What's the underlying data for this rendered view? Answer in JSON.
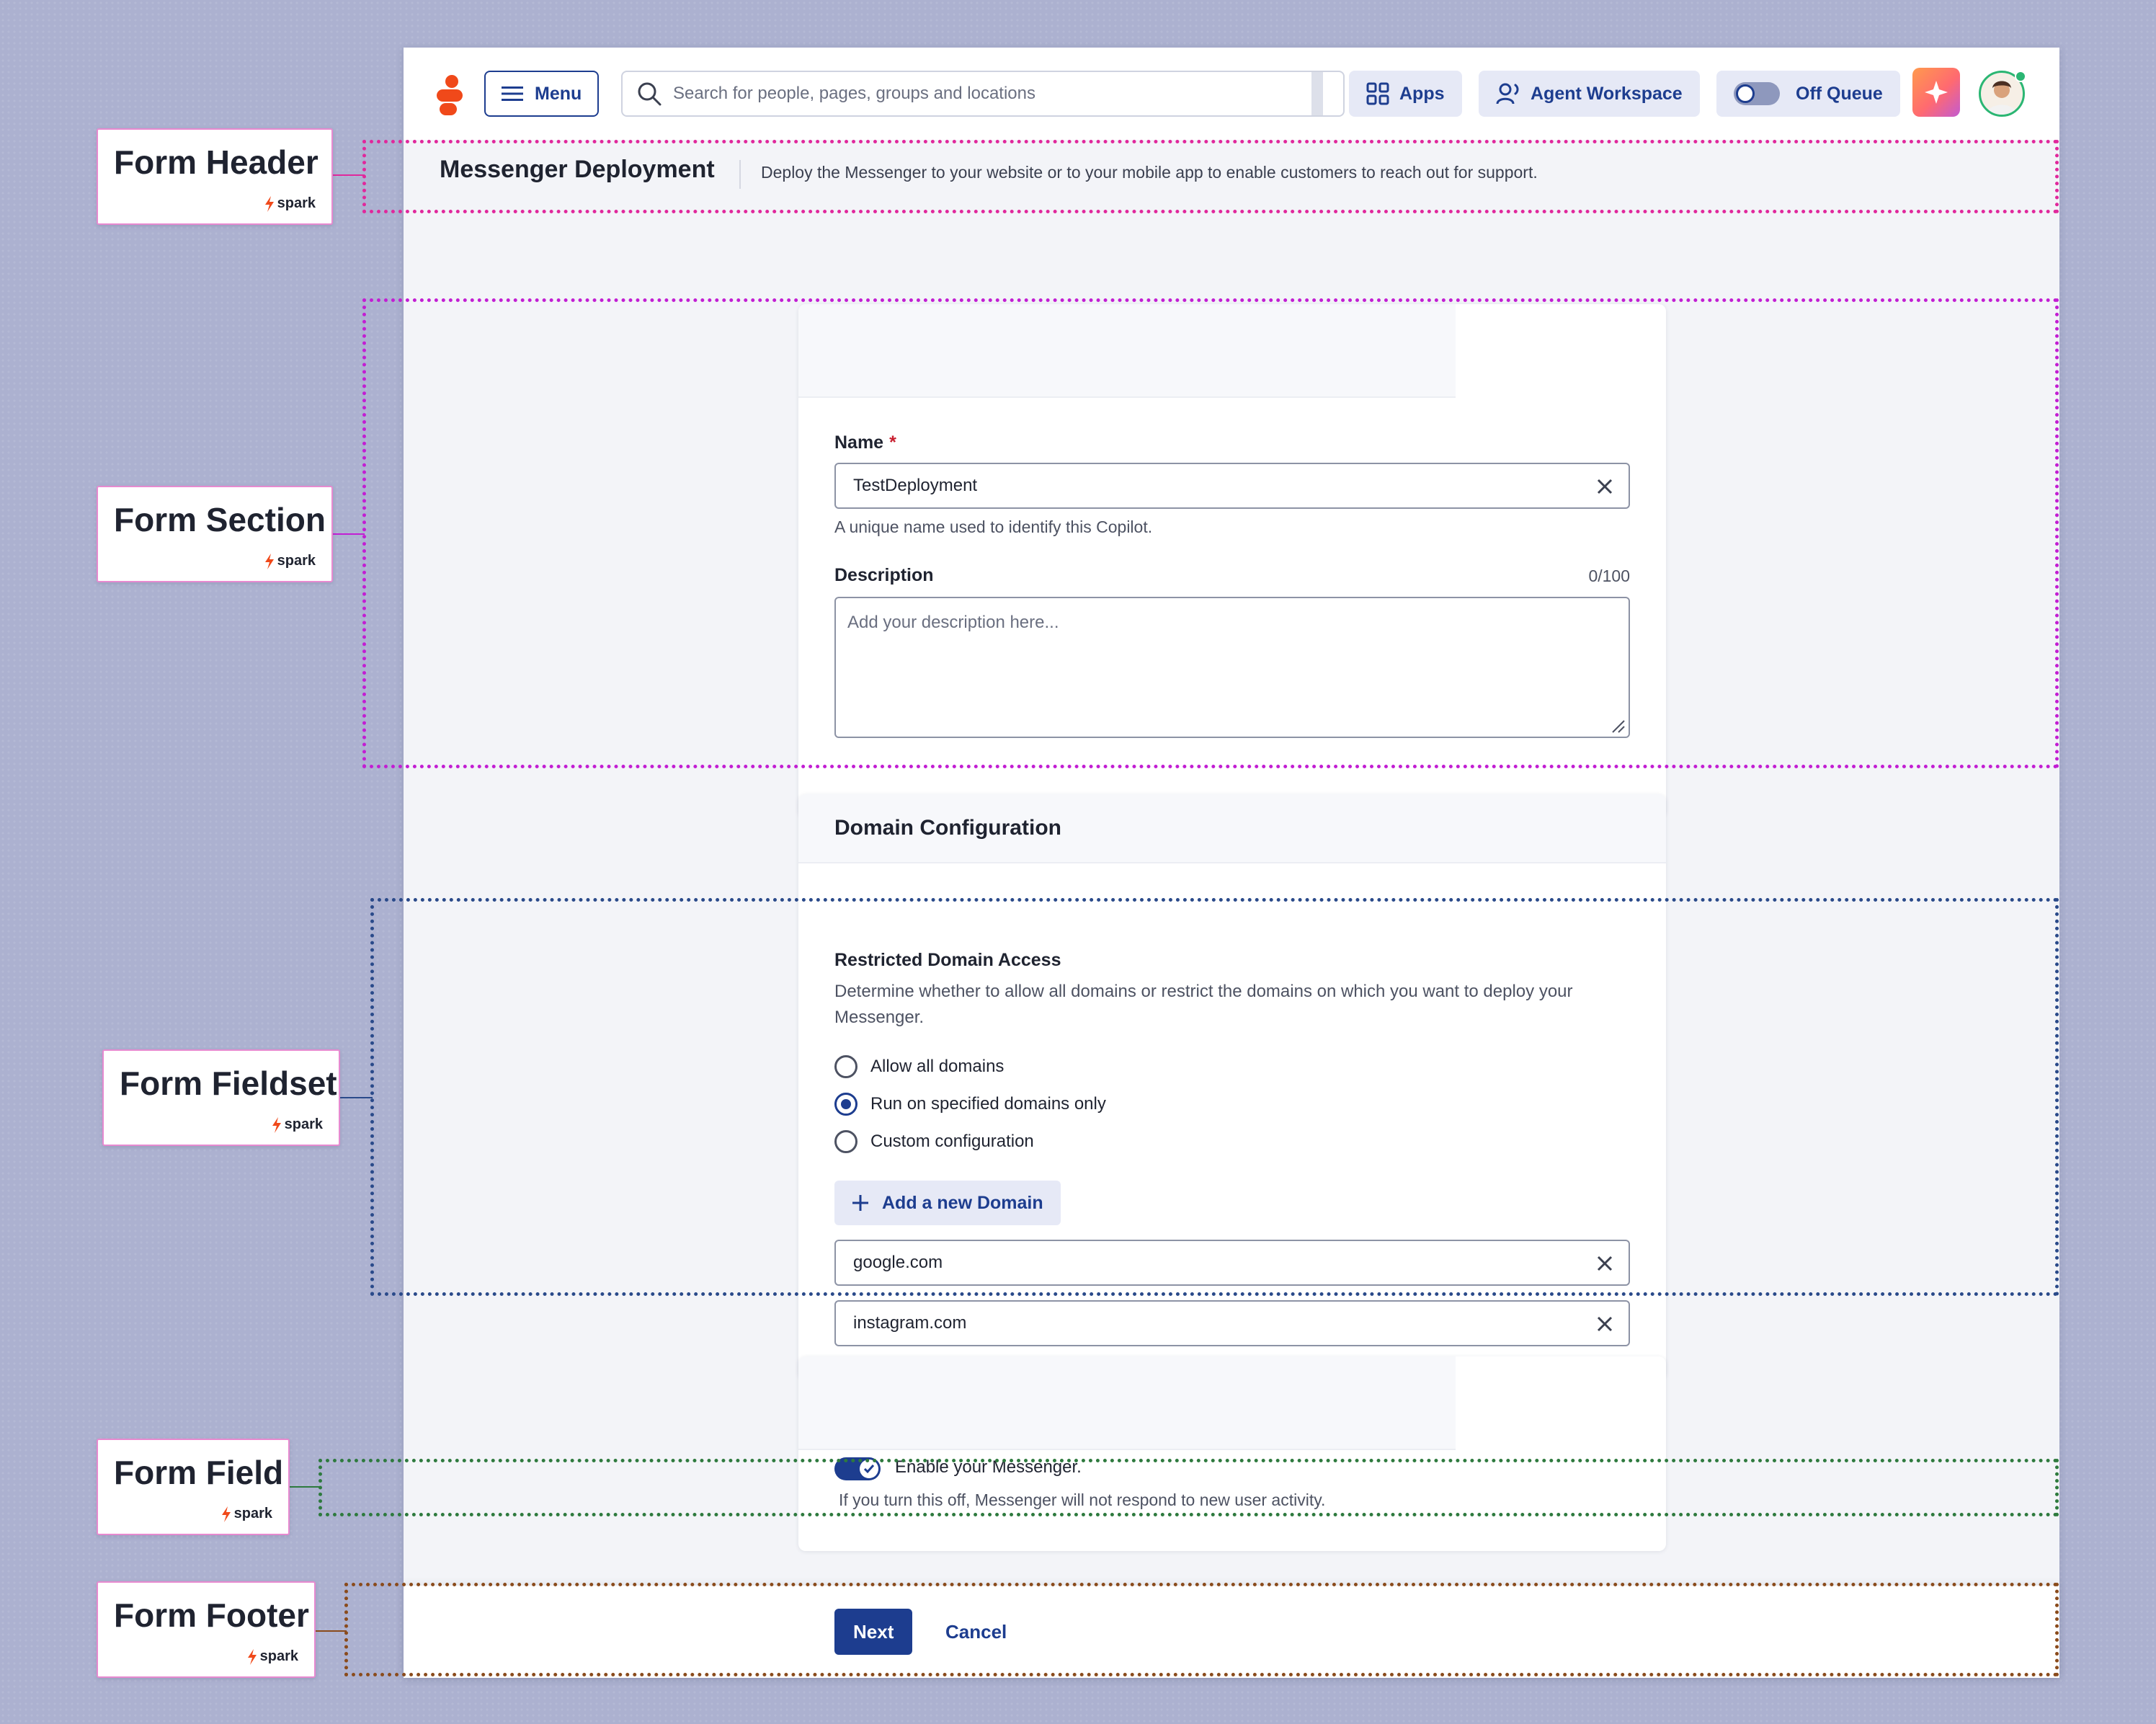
{
  "topbar": {
    "menu_label": "Menu",
    "search_placeholder": "Search for people, pages, groups and locations",
    "apps_label": "Apps",
    "agent_workspace_label": "Agent Workspace",
    "queue_label": "Off Queue",
    "icons": [
      "logo",
      "hamburger-icon",
      "search-icon",
      "apps-grid-icon",
      "agent-headset-icon",
      "sparkle-icon",
      "avatar"
    ]
  },
  "page_header": {
    "title": "Messenger Deployment",
    "subtitle": "Deploy the Messenger to your website or to your mobile app to enable customers to reach out for support."
  },
  "general": {
    "name_label": "Name",
    "required_mark": "*",
    "name_value": "TestDeployment",
    "name_helper": "A unique name used to identify this Copilot.",
    "description_label": "Description",
    "description_counter": "0/100",
    "description_placeholder": "Add your description here..."
  },
  "domain": {
    "section_title": "Domain Configuration",
    "fieldset_title": "Restricted Domain Access",
    "fieldset_description": "Determine whether to allow all domains or restrict the domains on which you want to deploy your Messenger.",
    "options": [
      {
        "label": "Allow all domains",
        "selected": false
      },
      {
        "label": "Run on specified domains only",
        "selected": true
      },
      {
        "label": "Custom configuration",
        "selected": false
      }
    ],
    "add_button": "Add a new Domain",
    "domains": [
      "google.com",
      "instagram.com"
    ]
  },
  "enable": {
    "toggle_on": true,
    "label": "Enable your Messenger.",
    "helper": "If you turn this off, Messenger will not respond to new user activity."
  },
  "footer": {
    "next_label": "Next",
    "cancel_label": "Cancel"
  },
  "annotations": {
    "brand": "spark",
    "labels": [
      {
        "text": "Form Header",
        "color": "#e0289c"
      },
      {
        "text": "Form Section",
        "color": "#c21ed3"
      },
      {
        "text": "Form Fieldset",
        "color": "#2a4a8a"
      },
      {
        "text": "Form Field",
        "color": "#2e7a3e"
      },
      {
        "text": "Form Footer",
        "color": "#8a4b1c"
      }
    ]
  },
  "colors": {
    "primary": "#1d3d8f",
    "brand_orange": "#f0491a",
    "required": "#c81e2e",
    "backdrop": "#acb1d0"
  }
}
